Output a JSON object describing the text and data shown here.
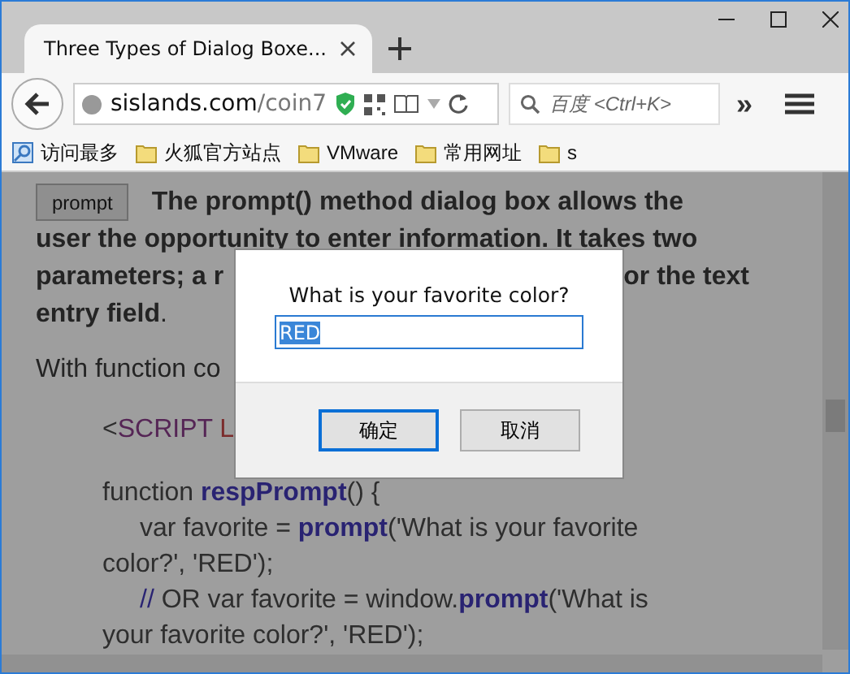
{
  "window": {
    "tab_title": "Three Types of Dialog Boxe..."
  },
  "toolbar": {
    "url_host": "sislands.com",
    "url_path": "/coin7",
    "search_placeholder": "百度 <Ctrl+K>",
    "overflow": "»"
  },
  "bookmarks": [
    {
      "label": "访问最多",
      "kind": "smart"
    },
    {
      "label": "火狐官方站点",
      "kind": "folder"
    },
    {
      "label": "VMware",
      "kind": "folder"
    },
    {
      "label": "常用网址",
      "kind": "folder"
    },
    {
      "label": "s",
      "kind": "folder"
    }
  ],
  "page": {
    "button": "prompt",
    "intro_lines": [
      [
        "The prompt() method dialog box allows the"
      ],
      [
        "user the opportunity to enter information.  It takes two"
      ],
      [
        "parameters; a r",
        "or the text"
      ],
      [
        "entry field"
      ]
    ],
    "intro_end": ".",
    "with_text": "With function co",
    "code_blocks": [
      [
        {
          "indent": false,
          "segments": [
            {
              "kind": "plain",
              "text": "<"
            },
            {
              "kind": "tag",
              "text": "SCRIPT"
            },
            {
              "kind": "attr",
              "text": " L"
            }
          ]
        }
      ],
      [
        {
          "indent": false,
          "segments": [
            {
              "kind": "plain",
              "text": "function "
            },
            {
              "kind": "keyword",
              "text": "respPrompt"
            },
            {
              "kind": "plain",
              "text": "() {"
            }
          ]
        },
        {
          "indent": true,
          "segments": [
            {
              "kind": "plain",
              "text": "var favorite = "
            },
            {
              "kind": "keyword",
              "text": "prompt"
            },
            {
              "kind": "plain",
              "text": "('What is your favorite"
            }
          ]
        },
        {
          "indent": false,
          "segments": [
            {
              "kind": "plain",
              "text": "color?', 'RED');"
            }
          ]
        },
        {
          "indent": true,
          "segments": [
            {
              "kind": "comment",
              "text": "// "
            },
            {
              "kind": "plain",
              "text": "OR var favorite = window."
            },
            {
              "kind": "keyword",
              "text": "prompt"
            },
            {
              "kind": "plain",
              "text": "('What is"
            }
          ]
        },
        {
          "indent": false,
          "segments": [
            {
              "kind": "plain",
              "text": "your favorite color?', 'RED');"
            }
          ]
        }
      ]
    ]
  },
  "dialog": {
    "message": "What is your favorite color?",
    "value": "RED",
    "value_selected": true,
    "buttons": [
      {
        "label": "确定",
        "focused": true
      },
      {
        "label": "取消",
        "focused": false
      }
    ]
  }
}
